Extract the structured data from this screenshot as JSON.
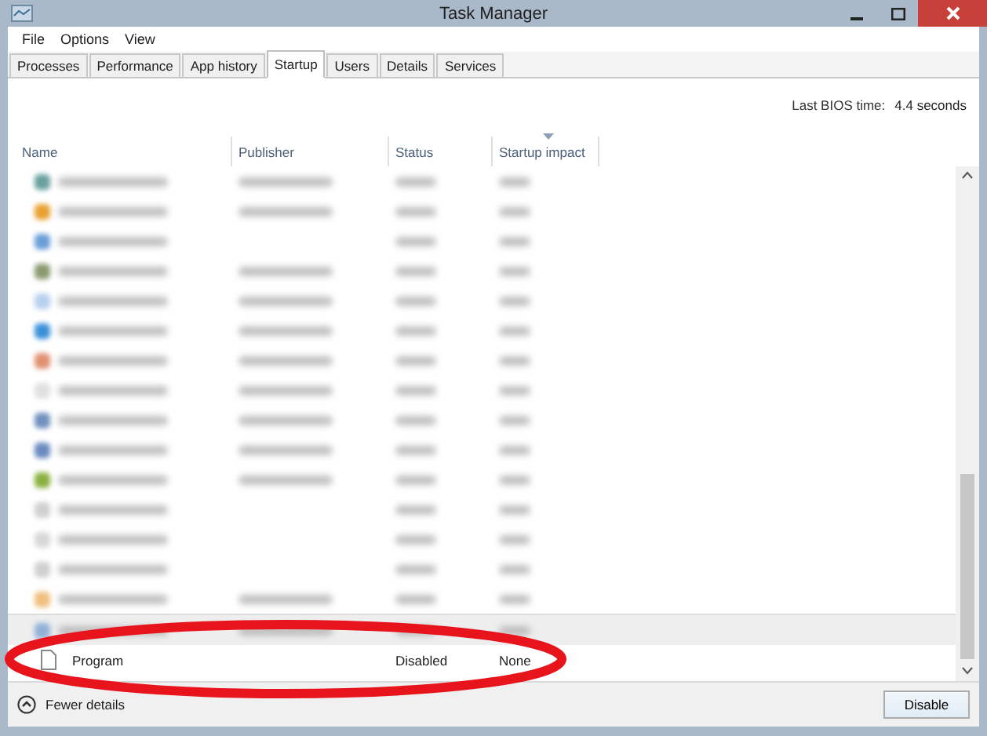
{
  "window": {
    "title": "Task Manager"
  },
  "menu": [
    "File",
    "Options",
    "View"
  ],
  "tabs": [
    {
      "label": "Processes",
      "selected": false
    },
    {
      "label": "Performance",
      "selected": false
    },
    {
      "label": "App history",
      "selected": false
    },
    {
      "label": "Startup",
      "selected": true
    },
    {
      "label": "Users",
      "selected": false
    },
    {
      "label": "Details",
      "selected": false
    },
    {
      "label": "Services",
      "selected": false
    }
  ],
  "bios": {
    "label": "Last BIOS time:",
    "value": "4.4 seconds"
  },
  "columns": [
    {
      "label": "Name",
      "sorted": false
    },
    {
      "label": "Publisher",
      "sorted": false
    },
    {
      "label": "Status",
      "sorted": false
    },
    {
      "label": "Startup impact",
      "sorted": true
    }
  ],
  "rows": [
    {
      "kind": "blurred",
      "color": "#6aa0a0",
      "publisher_shown": true,
      "selected": false
    },
    {
      "kind": "blurred",
      "color": "#e8a030",
      "publisher_shown": true,
      "selected": false
    },
    {
      "kind": "blurred",
      "color": "#6a9ed8",
      "publisher_shown": false,
      "selected": false
    },
    {
      "kind": "blurred",
      "color": "#8a9a70",
      "publisher_shown": true,
      "selected": false
    },
    {
      "kind": "blurred",
      "color": "#b8d0f0",
      "publisher_shown": true,
      "selected": false
    },
    {
      "kind": "blurred",
      "color": "#3a90d8",
      "publisher_shown": true,
      "selected": false
    },
    {
      "kind": "blurred",
      "color": "#e09070",
      "publisher_shown": true,
      "selected": false
    },
    {
      "kind": "blurred",
      "color": "#e0e0e0",
      "publisher_shown": true,
      "selected": false
    },
    {
      "kind": "blurred",
      "color": "#7090c0",
      "publisher_shown": true,
      "selected": false
    },
    {
      "kind": "blurred",
      "color": "#6a8ac0",
      "publisher_shown": true,
      "selected": false
    },
    {
      "kind": "blurred",
      "color": "#8ab040",
      "publisher_shown": true,
      "selected": false
    },
    {
      "kind": "blurred",
      "color": "#d0d0d0",
      "publisher_shown": false,
      "selected": false
    },
    {
      "kind": "blurred",
      "color": "#d8d8d8",
      "publisher_shown": false,
      "selected": false
    },
    {
      "kind": "blurred",
      "color": "#d0d0d0",
      "publisher_shown": false,
      "selected": false
    },
    {
      "kind": "blurred",
      "color": "#f0c080",
      "publisher_shown": true,
      "selected": false
    },
    {
      "kind": "blurred",
      "color": "#90b0d8",
      "publisher_shown": true,
      "selected": true
    },
    {
      "kind": "entry",
      "name": "Program",
      "status": "Disabled",
      "impact": "None",
      "selected": false
    }
  ],
  "footer": {
    "toggle": "Fewer details",
    "button": "Disable"
  },
  "annotation": {
    "kind": "ellipse",
    "color": "#e8141c"
  }
}
